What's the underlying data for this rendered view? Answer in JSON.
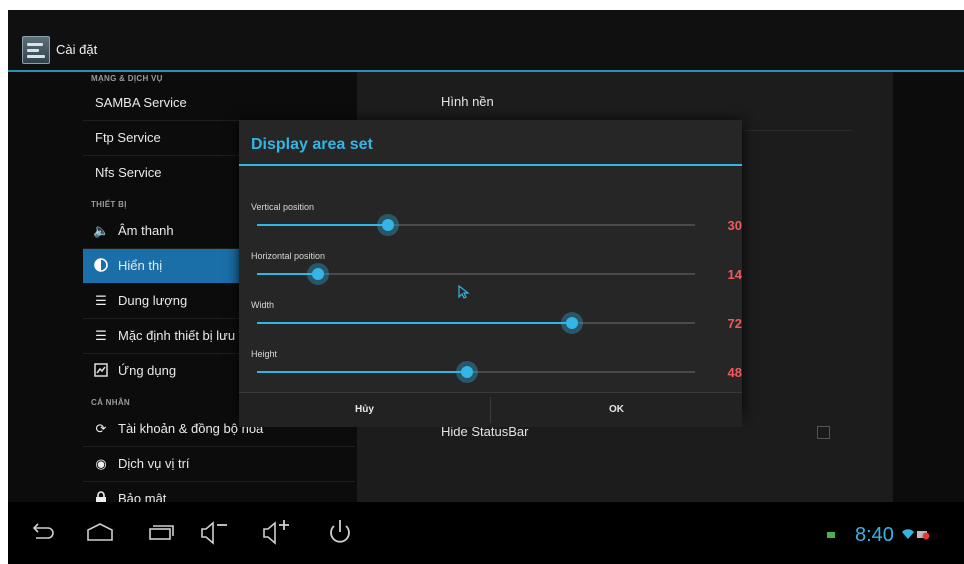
{
  "app": {
    "title": "Cài đặt"
  },
  "left_list": {
    "sections": [
      {
        "header": "MẠNG & DỊCH VỤ"
      },
      {
        "header": "THIẾT BỊ"
      },
      {
        "header": "CÁ NHÂN"
      }
    ],
    "items": [
      {
        "label": "SAMBA Service"
      },
      {
        "label": "Ftp Service"
      },
      {
        "label": "Nfs Service"
      },
      {
        "label": "Âm thanh",
        "icon": "speaker-icon"
      },
      {
        "label": "Hiển thị",
        "icon": "display-icon",
        "selected": true
      },
      {
        "label": "Dung lượng",
        "icon": "storage-icon"
      },
      {
        "label": "Mặc định thiết bị lưu",
        "icon": "default-storage-icon"
      },
      {
        "label": "Ứng dụng",
        "icon": "apps-icon"
      },
      {
        "label": "Tài khoản & đồng bộ hóa",
        "icon": "sync-icon"
      },
      {
        "label": "Dịch vụ vị trí",
        "icon": "location-icon"
      },
      {
        "label": "Bảo mật",
        "icon": "lock-icon"
      }
    ]
  },
  "right_panel": {
    "items": [
      {
        "label": "Hình nền"
      },
      {
        "label": "Hide StatusBar",
        "checked": false
      }
    ]
  },
  "dialog": {
    "title": "Display area set",
    "sliders": [
      {
        "label": "Vertical position",
        "value": "30",
        "fraction": 0.3
      },
      {
        "label": "Horizontal position",
        "value": "14",
        "fraction": 0.14
      },
      {
        "label": "Width",
        "value": "72",
        "fraction": 0.72
      },
      {
        "label": "Height",
        "value": "48",
        "fraction": 0.48
      }
    ],
    "cancel_label": "Hủy",
    "ok_label": "OK"
  },
  "status": {
    "time": "8:40"
  },
  "colors": {
    "accent": "#33b5e5",
    "value_red": "#f05a5a",
    "selected_bg": "#1a6fa8"
  }
}
